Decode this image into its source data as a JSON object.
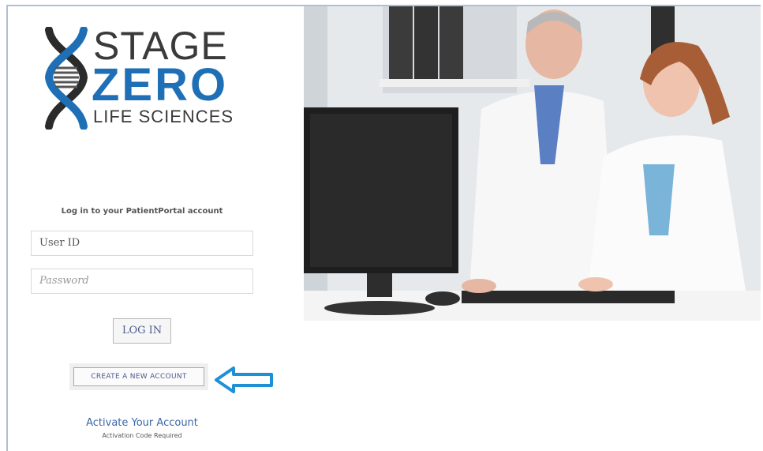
{
  "brand": {
    "line1": "STAGE",
    "line2": "ZERO",
    "line3": "LIFE SCIENCES",
    "colors": {
      "dark": "#3a3a3a",
      "blue": "#1f6fb6"
    }
  },
  "login": {
    "heading": "Log in to your PatientPortal account",
    "user_value": "User ID",
    "password_placeholder": "Password",
    "login_button": "LOG IN",
    "create_button": "CREATE A NEW ACCOUNT",
    "activate_link": "Activate Your Account",
    "activate_sub": "Activation Code Required"
  },
  "annotation": {
    "arrow_color": "#1e90d6",
    "icon": "left-arrow-icon"
  }
}
